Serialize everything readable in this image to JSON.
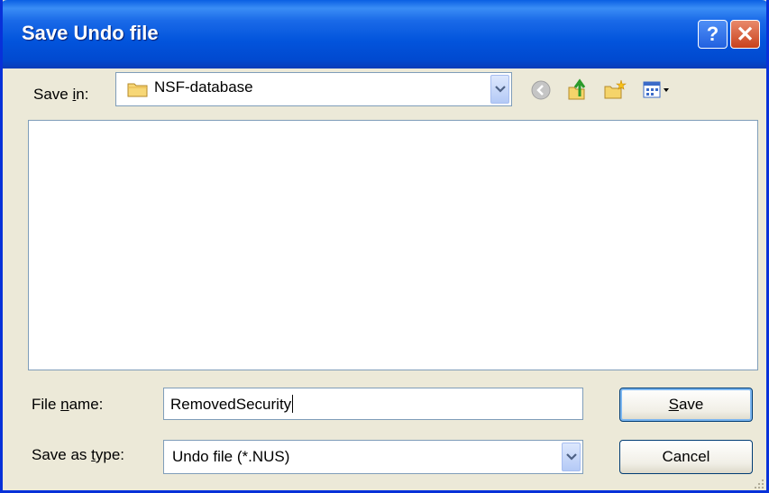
{
  "window": {
    "title": "Save Undo file",
    "help_glyph": "?",
    "close_glyph": "✕"
  },
  "toolbar": {
    "save_in_prefix": "Save ",
    "save_in_accel": "i",
    "save_in_suffix": "n:",
    "location_value": "NSF-database",
    "icons": [
      "folder-icon",
      "back-icon",
      "up-one-level-icon",
      "create-new-folder-icon",
      "view-menu-icon"
    ]
  },
  "form": {
    "file_name_prefix": "File ",
    "file_name_accel": "n",
    "file_name_suffix": "ame:",
    "file_name_value": "RemovedSecurity",
    "save_type_prefix": "Save as ",
    "save_type_accel": "t",
    "save_type_suffix": "ype:",
    "save_type_value": "Undo file (*.NUS)"
  },
  "buttons": {
    "save_accel": "S",
    "save_rest": "ave",
    "cancel_label": "Cancel"
  },
  "colors": {
    "titlebar": "#0254dc",
    "dialog_bg": "#ece9d8",
    "border": "#7f9db9"
  }
}
